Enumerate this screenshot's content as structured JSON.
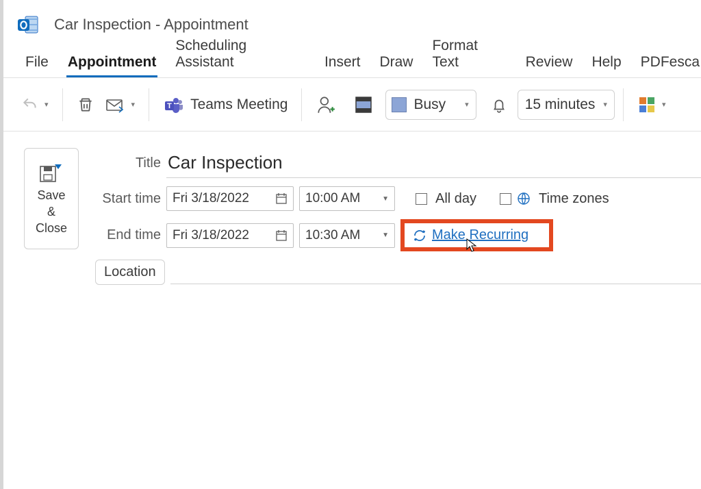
{
  "titlebar": {
    "title": "Car Inspection  -  Appointment"
  },
  "tabs": {
    "file": "File",
    "appointment": "Appointment",
    "scheduling": "Scheduling Assistant",
    "insert": "Insert",
    "draw": "Draw",
    "format": "Format Text",
    "review": "Review",
    "help": "Help",
    "pdfescape": "PDFesca"
  },
  "toolbar": {
    "teams": "Teams Meeting",
    "busy": "Busy",
    "reminder": "15 minutes"
  },
  "form": {
    "saveClose1": "Save",
    "saveClose2": "&",
    "saveClose3": "Close",
    "titleLabel": "Title",
    "title": "Car Inspection",
    "startLabel": "Start time",
    "endLabel": "End time",
    "startDate": "Fri 3/18/2022",
    "startTime": "10:00 AM",
    "endDate": "Fri 3/18/2022",
    "endTime": "10:30 AM",
    "allDay": "All day",
    "timeZones": "Time zones",
    "recurring": "Make Recurring",
    "locationLabel": "Location",
    "location": ""
  }
}
